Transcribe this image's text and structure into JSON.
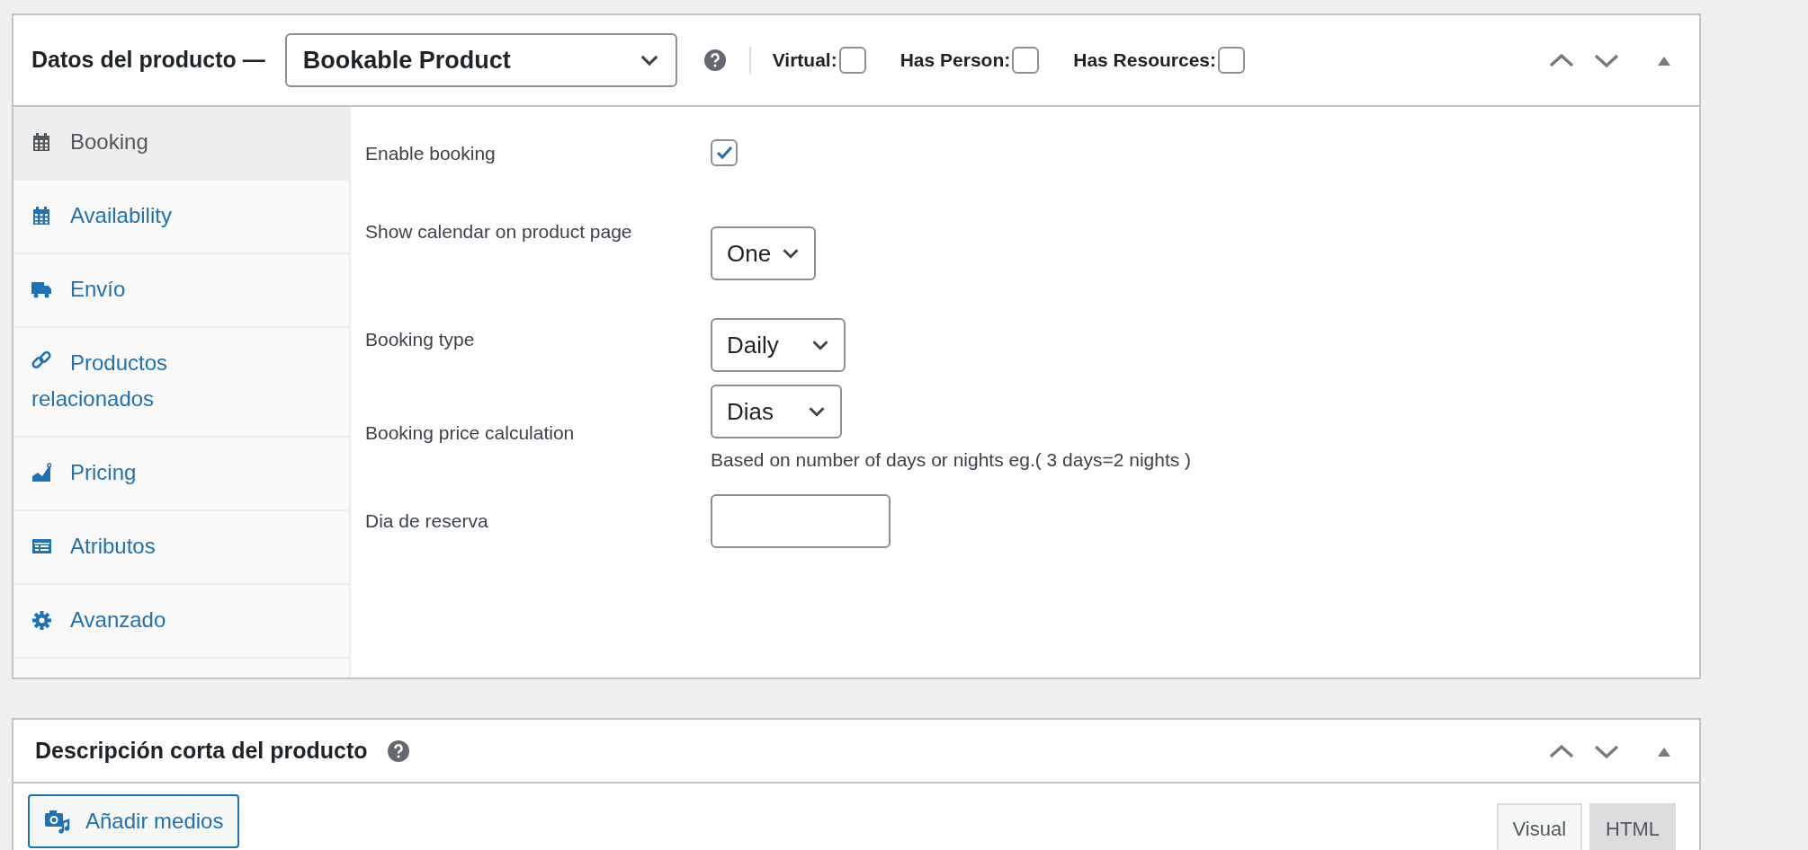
{
  "product_data": {
    "title": "Datos del producto —",
    "product_type": "Bookable Product",
    "options": [
      {
        "label": "Virtual:",
        "checked": false
      },
      {
        "label": "Has Person:",
        "checked": false
      },
      {
        "label": "Has Resources:",
        "checked": false
      }
    ],
    "tabs": [
      {
        "label": "Booking",
        "kind": "calendar",
        "selected": true
      },
      {
        "label": "Availability",
        "kind": "calendar",
        "selected": false
      },
      {
        "label": "Envío",
        "kind": "truck",
        "selected": false
      },
      {
        "label": "Productos relacionados",
        "kind": "link",
        "selected": false
      },
      {
        "label": "Pricing",
        "kind": "chart",
        "selected": false
      },
      {
        "label": "Atributos",
        "kind": "list",
        "selected": false
      },
      {
        "label": "Avanzado",
        "kind": "gear",
        "selected": false
      }
    ],
    "fields": [
      {
        "kind": "checkbox",
        "label": "Enable booking",
        "checked": true
      },
      {
        "kind": "select",
        "label": "Show calendar on product page",
        "value": "One"
      },
      {
        "kind": "select",
        "label": "Booking type",
        "value": "Daily"
      },
      {
        "kind": "select",
        "label": "Booking price calculation",
        "value": "Dias",
        "description": "Based on number of days or nights eg.( 3 days=2 nights )"
      },
      {
        "kind": "text",
        "label": "Dia de reserva"
      }
    ]
  },
  "short_description": {
    "title": "Descripción corta del producto",
    "add_media": "Añadir medios",
    "editor_tabs": [
      {
        "label": "Visual",
        "selected": true
      },
      {
        "label": "HTML",
        "selected": false
      }
    ]
  }
}
